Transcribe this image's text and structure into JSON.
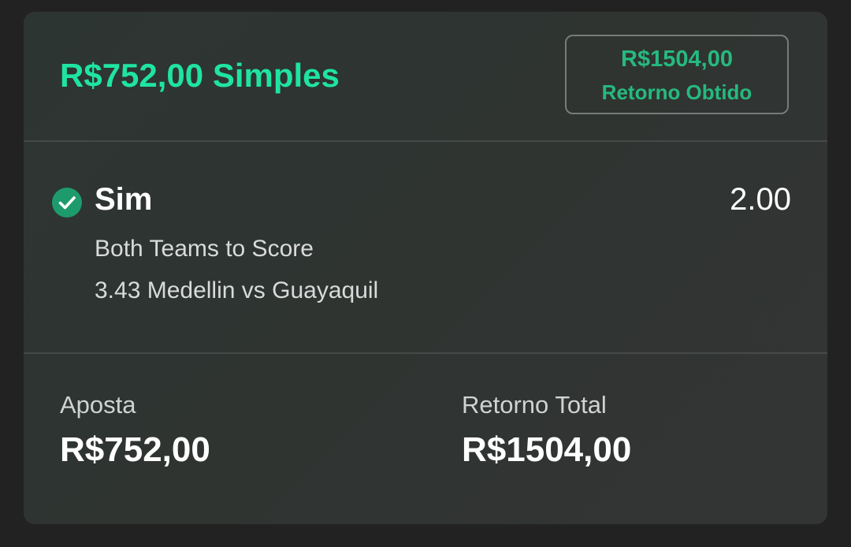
{
  "header": {
    "title": "R$752,00 Simples",
    "return_amount": "R$1504,00",
    "return_label": "Retorno Obtido"
  },
  "selection": {
    "status_icon": "check-circle-icon",
    "name": "Sim",
    "odds": "2.00",
    "market": "Both Teams to Score",
    "event": "3.43 Medellin vs Guayaquil"
  },
  "summary": {
    "stake_label": "Aposta",
    "stake_value": "R$752,00",
    "total_label": "Retorno Total",
    "total_value": "R$1504,00"
  },
  "colors": {
    "accent": "#1fe4a1",
    "accent_dark": "#26b980",
    "card_bg": "#2f3431",
    "page_bg": "#222222",
    "check_bg": "#1d9b6c"
  }
}
